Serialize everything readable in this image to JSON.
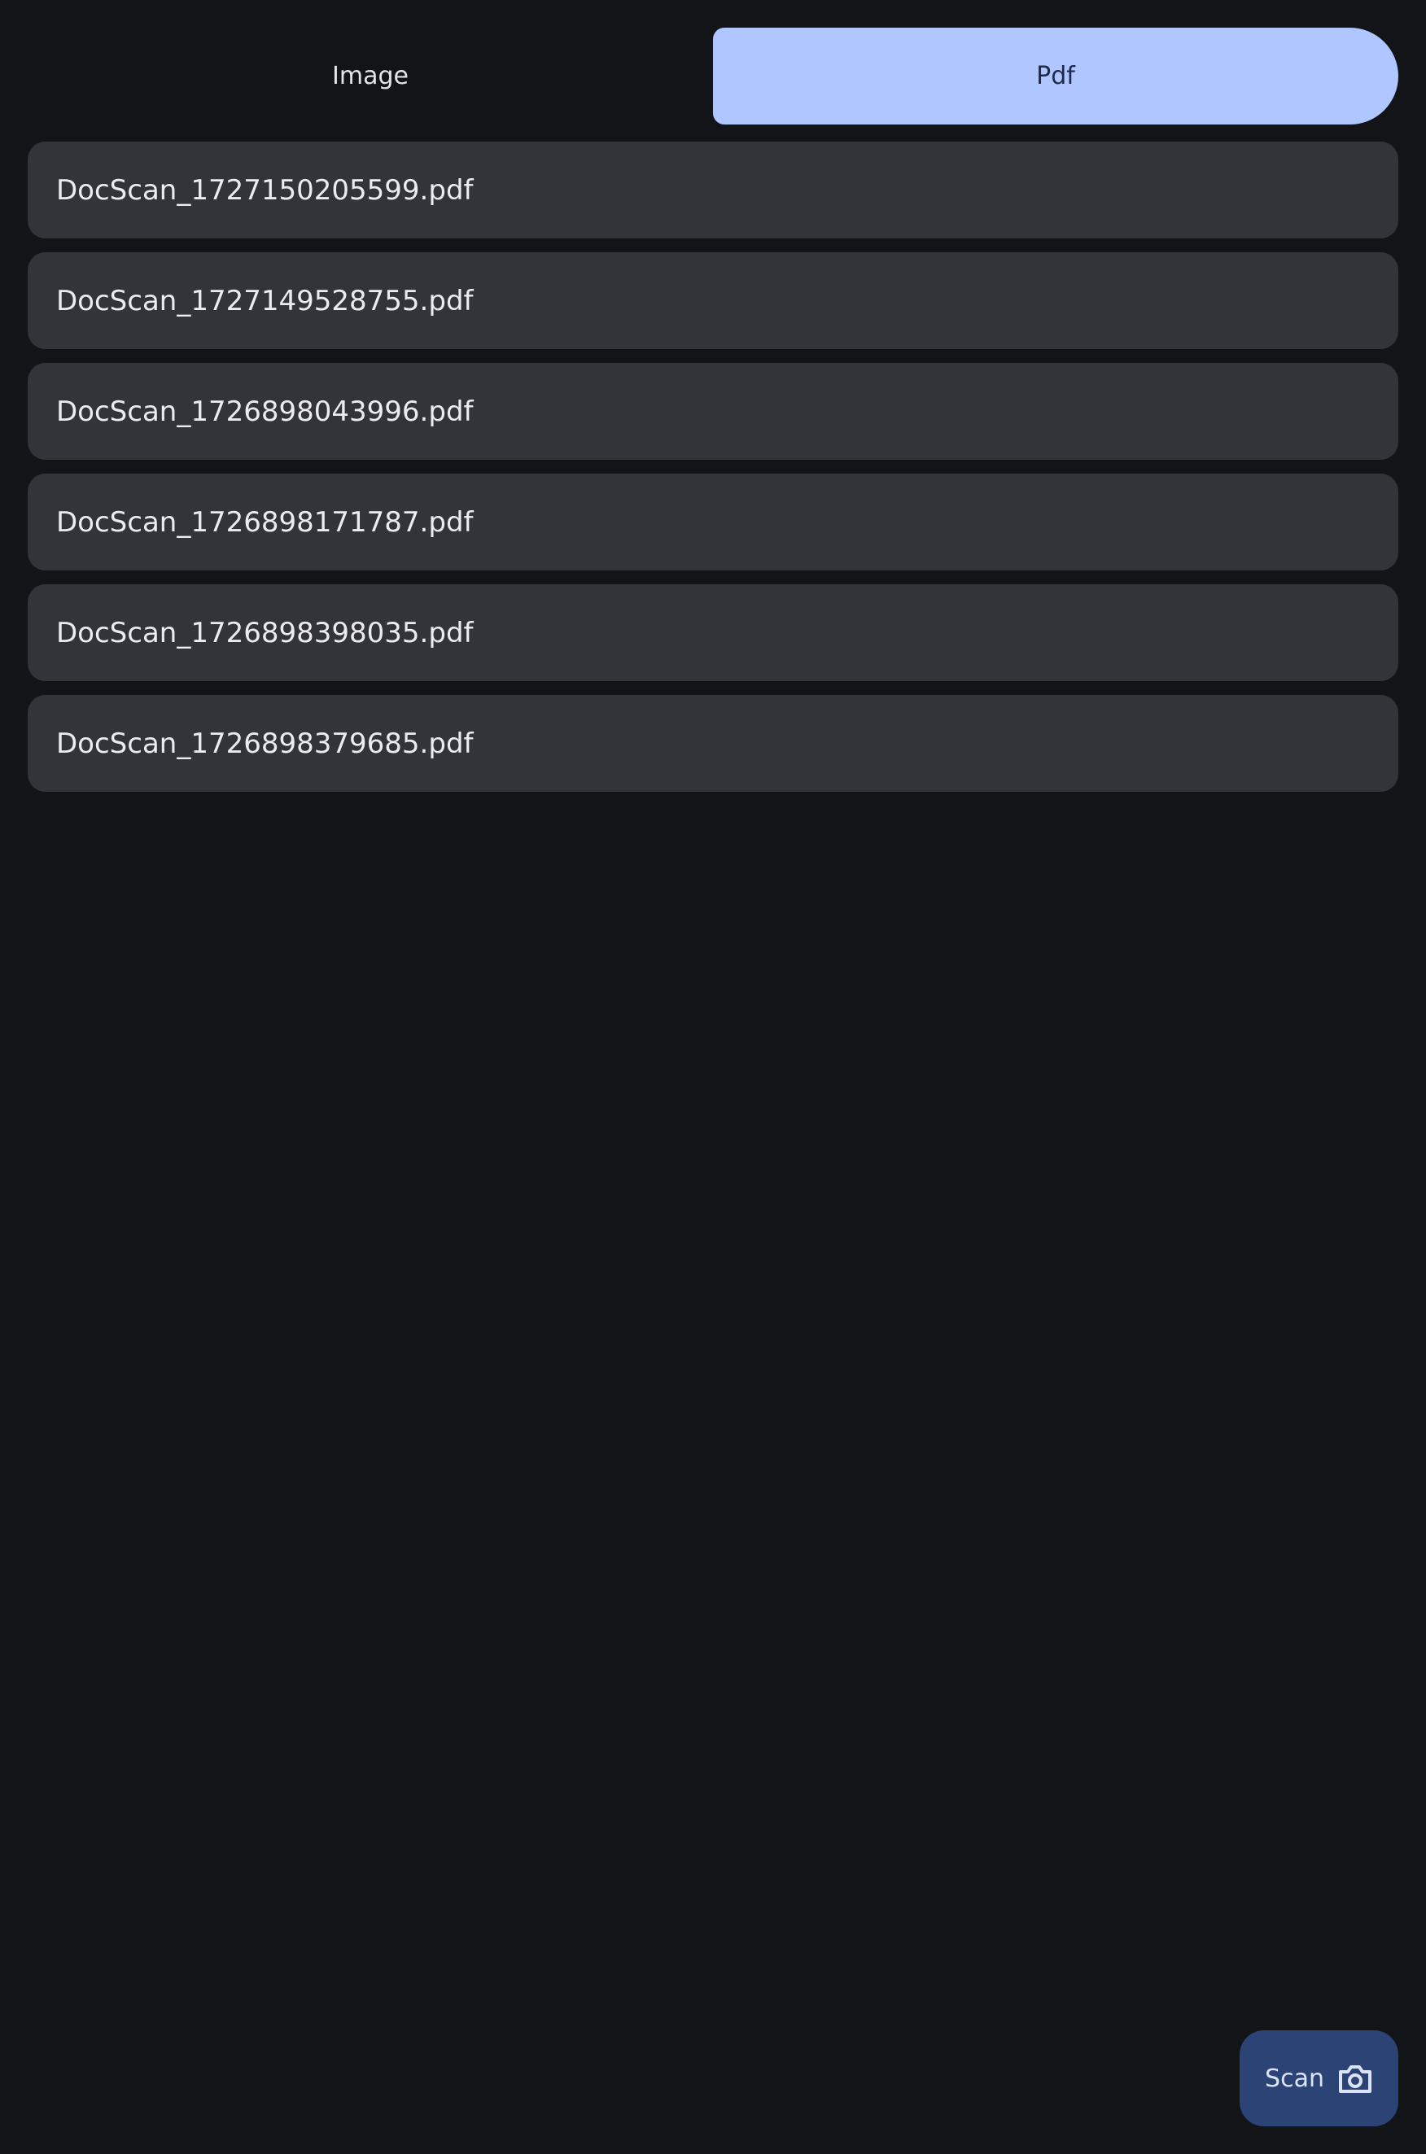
{
  "tabs": {
    "image_label": "Image",
    "pdf_label": "Pdf",
    "active": "Pdf"
  },
  "files": [
    "DocScan_1727150205599.pdf",
    "DocScan_1727149528755.pdf",
    "DocScan_1726898043996.pdf",
    "DocScan_1726898171787.pdf",
    "DocScan_1726898398035.pdf",
    "DocScan_1726898379685.pdf"
  ],
  "fab": {
    "label": "Scan",
    "icon": "camera-icon"
  },
  "colors": {
    "background": "#131418",
    "active_tab": "#afc6ff",
    "list_item": "#333439",
    "fab": "#2c4375"
  }
}
